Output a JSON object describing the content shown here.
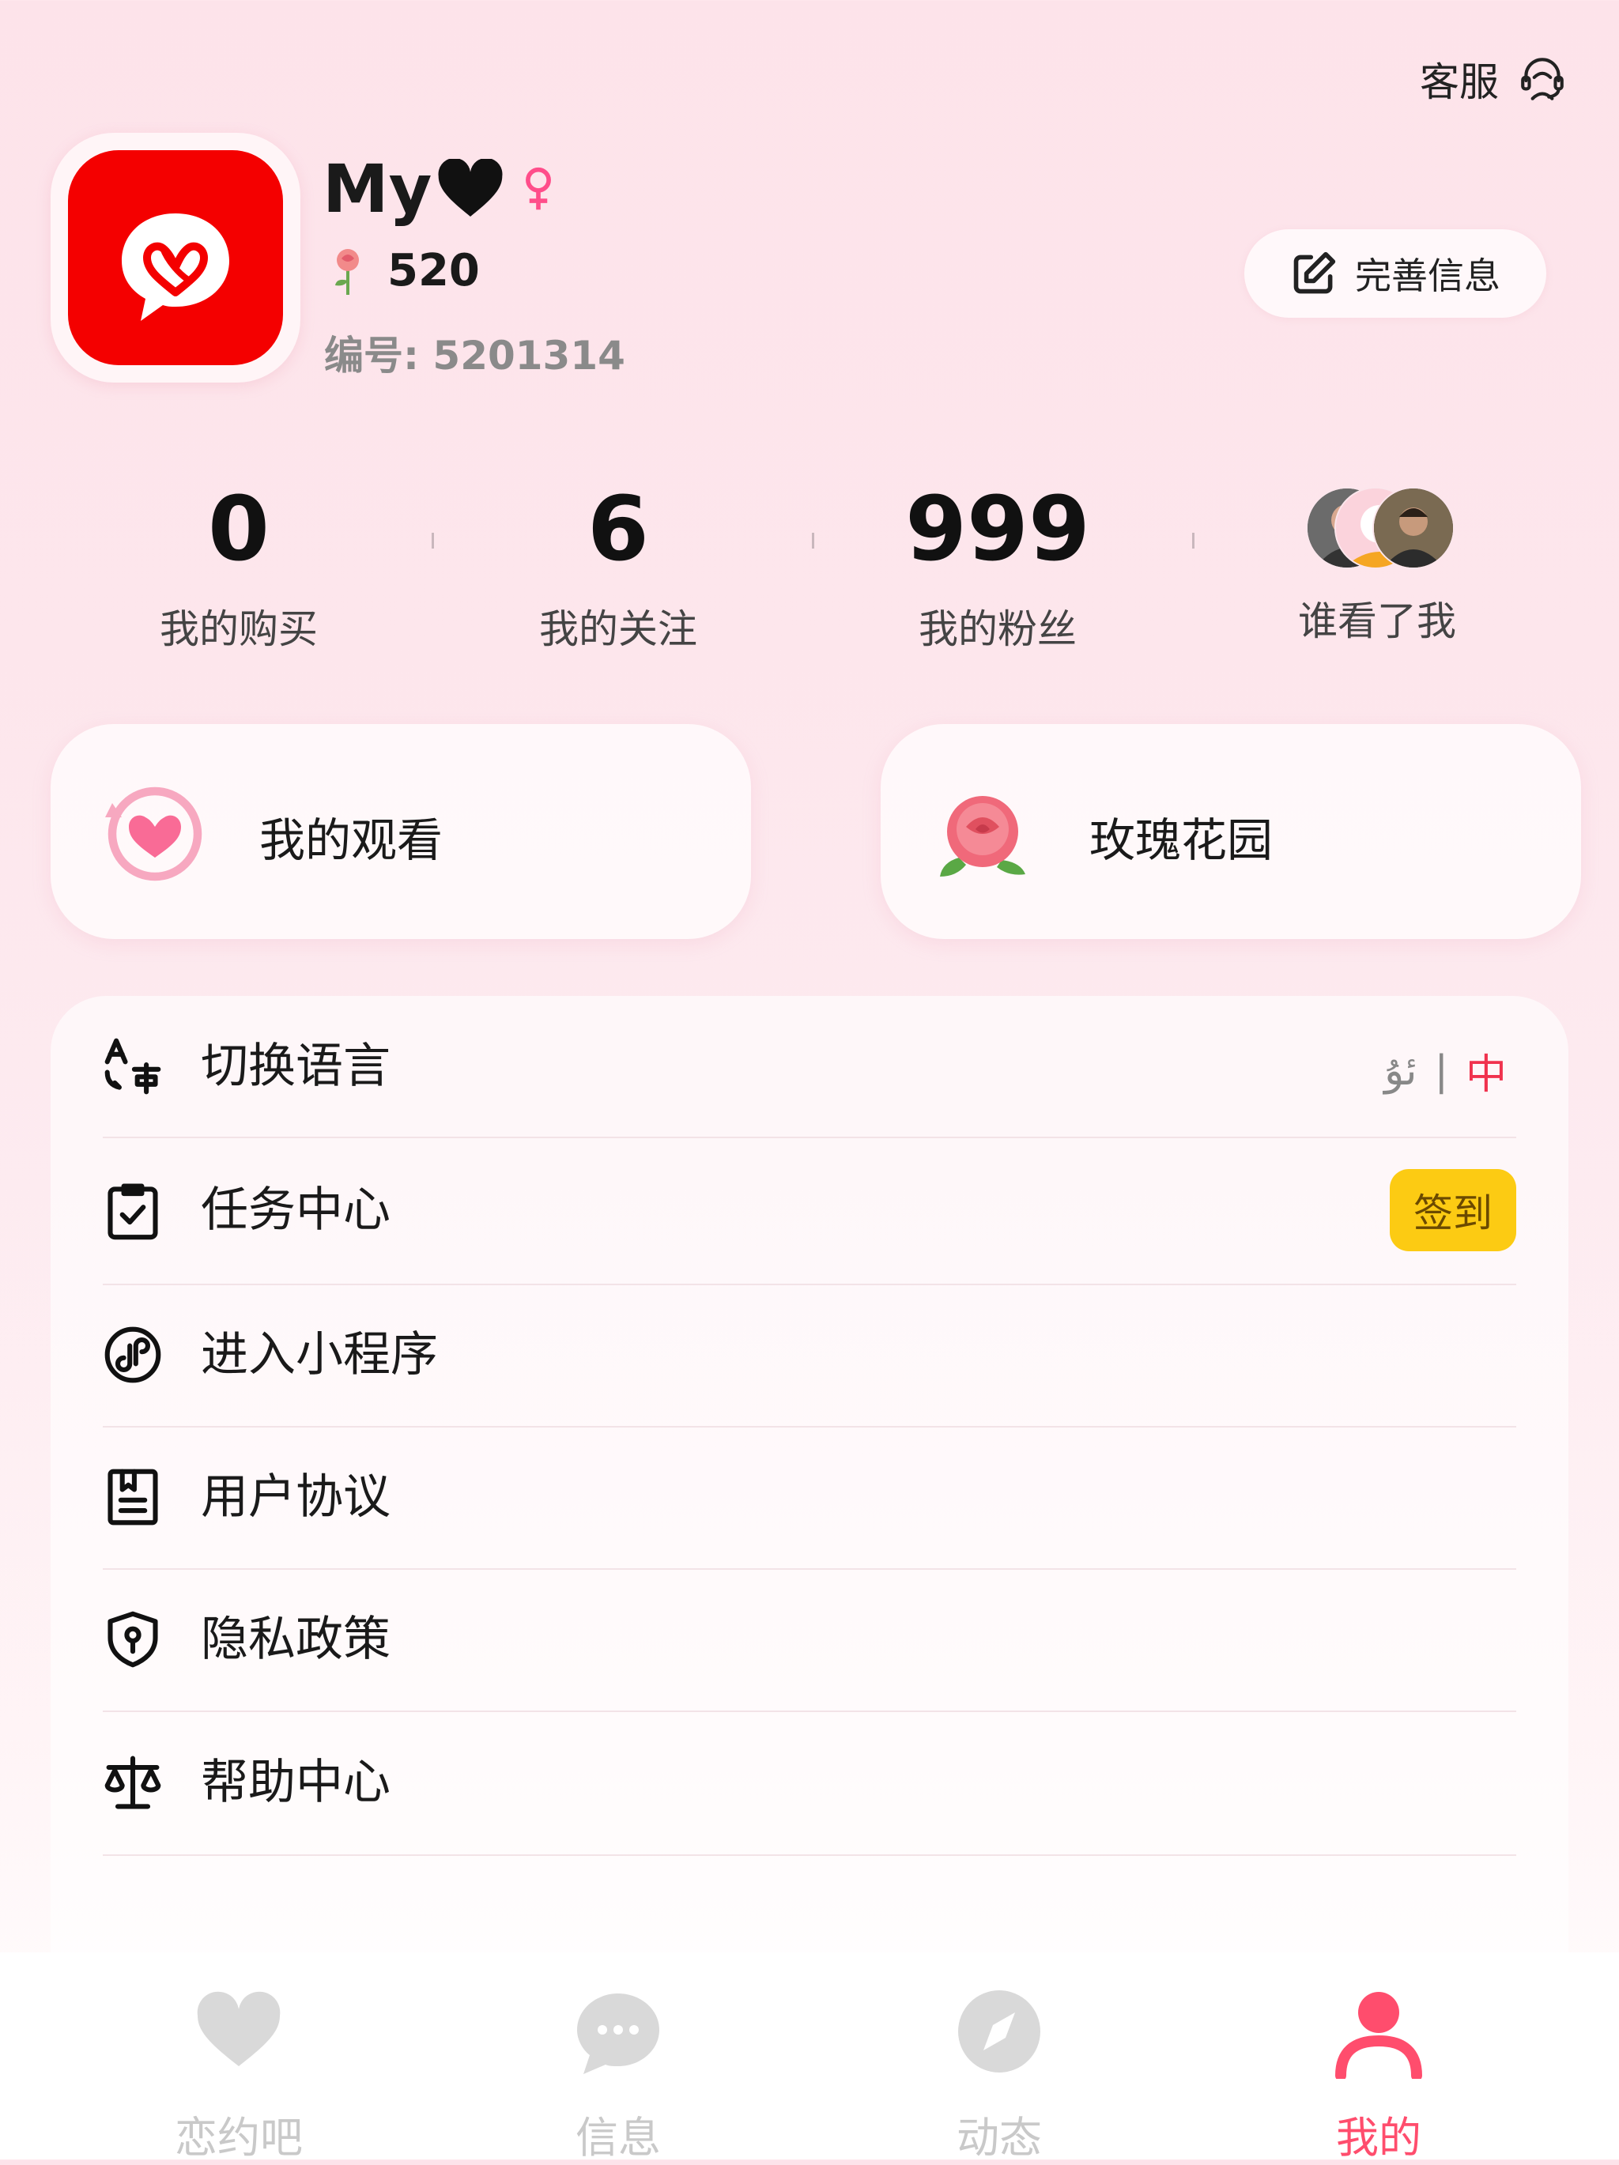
{
  "header": {
    "customer_service_label": "客服"
  },
  "profile": {
    "nickname": "My",
    "rose_count": "520",
    "id_line": "编号: 5201314",
    "edit_button_label": "完善信息"
  },
  "stats": [
    {
      "value": "0",
      "label": "我的购买"
    },
    {
      "value": "6",
      "label": "我的关注"
    },
    {
      "value": "999",
      "label": "我的粉丝"
    }
  ],
  "viewers": {
    "label": "谁看了我"
  },
  "shortcuts": [
    {
      "label": "我的观看",
      "icon": "heart-replay-icon"
    },
    {
      "label": "玫瑰花园",
      "icon": "rose-icon"
    }
  ],
  "menu": {
    "items": [
      {
        "label": "切换语言",
        "icon": "translate-icon"
      },
      {
        "label": "任务中心",
        "icon": "clipboard-check-icon"
      },
      {
        "label": "进入小程序",
        "icon": "mini-program-icon"
      },
      {
        "label": "用户协议",
        "icon": "agreement-icon"
      },
      {
        "label": "隐私政策",
        "icon": "shield-icon"
      },
      {
        "label": "帮助中心",
        "icon": "scale-icon"
      }
    ],
    "language_options": {
      "uyghur": "ئۇ",
      "separator": "|",
      "chinese": "中"
    },
    "checkin_label": "签到"
  },
  "tabbar": {
    "tabs": [
      {
        "label": "恋约吧",
        "icon": "heart-icon",
        "active": false
      },
      {
        "label": "信息",
        "icon": "chat-bubble-icon",
        "active": false
      },
      {
        "label": "动态",
        "icon": "compass-icon",
        "active": false
      },
      {
        "label": "我的",
        "icon": "person-icon",
        "active": true
      }
    ]
  },
  "colors": {
    "accent": "#ff4d6d",
    "brand_red": "#f40000",
    "checkin_yellow": "#fccb13",
    "language_active": "#f0324e"
  }
}
